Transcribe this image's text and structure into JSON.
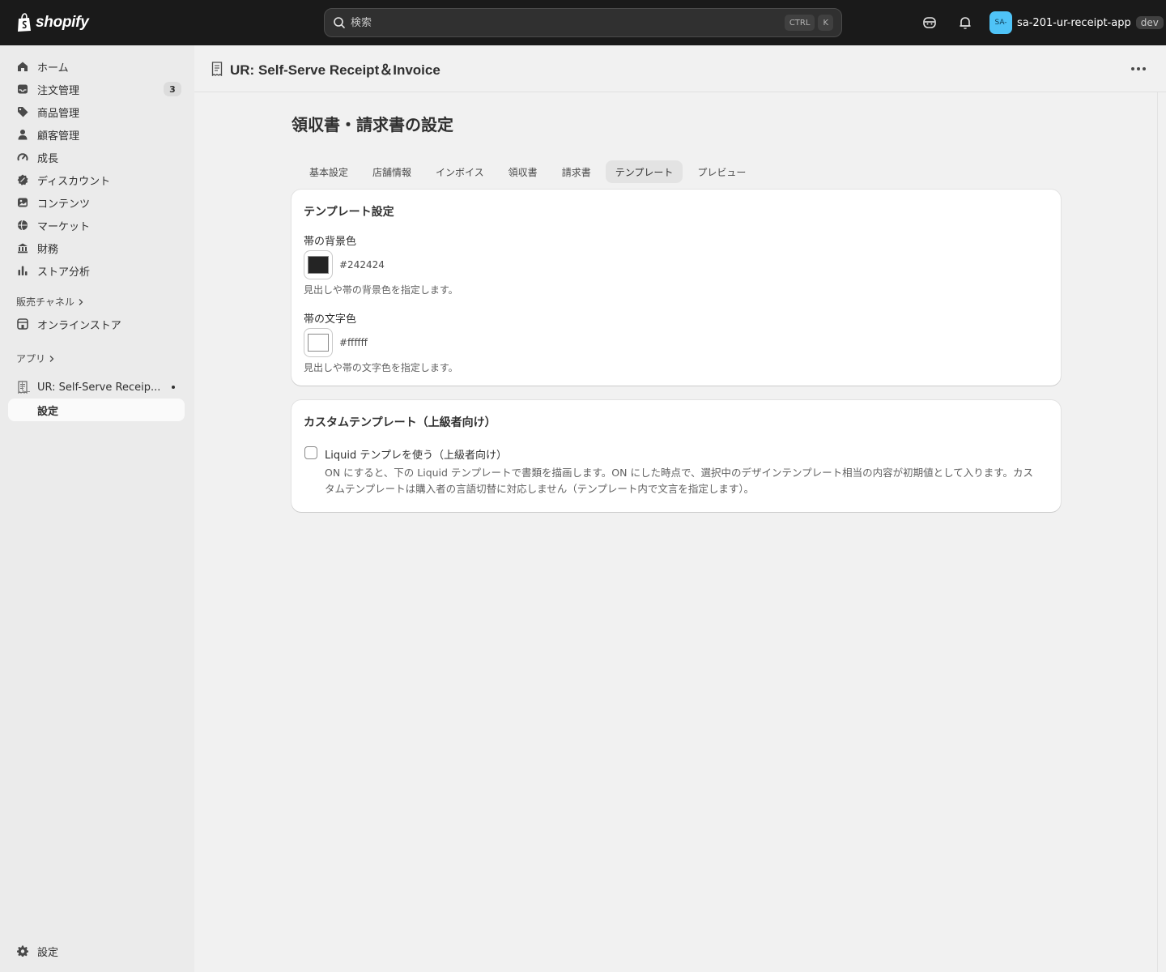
{
  "topbar": {
    "logo_text": "shopify",
    "search_placeholder": "検索",
    "shortcut": [
      "CTRL",
      "K"
    ],
    "account": {
      "avatar_text": "SA-",
      "store_name": "sa-201-ur-receipt-app",
      "badge": "dev"
    }
  },
  "sidebar": {
    "items": [
      {
        "label": "ホーム",
        "icon": "home-icon"
      },
      {
        "label": "注文管理",
        "icon": "inbox-icon",
        "badge": "3"
      },
      {
        "label": "商品管理",
        "icon": "tag-icon"
      },
      {
        "label": "顧客管理",
        "icon": "person-icon"
      },
      {
        "label": "成長",
        "icon": "gauge-icon"
      },
      {
        "label": "ディスカウント",
        "icon": "discount-icon"
      },
      {
        "label": "コンテンツ",
        "icon": "image-icon"
      },
      {
        "label": "マーケット",
        "icon": "globe-icon"
      },
      {
        "label": "財務",
        "icon": "bank-icon"
      },
      {
        "label": "ストア分析",
        "icon": "chart-icon"
      }
    ],
    "sales_channels_label": "販売チャネル",
    "online_store_label": "オンラインストア",
    "apps_label": "アプリ",
    "app_name": "UR: Self-Serve Receip...",
    "app_sub_item": "設定",
    "settings_label": "設定"
  },
  "main": {
    "app_title": "UR: Self-Serve Receipt＆Invoice",
    "page_title": "領収書・請求書の設定",
    "tabs": [
      "基本設定",
      "店舗情報",
      "インボイス",
      "領収書",
      "請求書",
      "テンプレート",
      "プレビュー"
    ],
    "selected_tab": 5,
    "template_card": {
      "title": "テンプレート設定",
      "bg_color_label": "帯の背景色",
      "bg_color_value": "#242424",
      "bg_color_help": "見出しや帯の背景色を指定します。",
      "text_color_label": "帯の文字色",
      "text_color_value": "#ffffff",
      "text_color_help": "見出しや帯の文字色を指定します。"
    },
    "custom_card": {
      "title": "カスタムテンプレート（上級者向け）",
      "checkbox_label": "Liquid テンプレを使う（上級者向け）",
      "checkbox_checked": false,
      "help": "ON にすると、下の Liquid テンプレートで書類を描画します。ON にした時点で、選択中のデザインテンプレート相当の内容が初期値として入ります。カスタムテンプレートは購入者の言語切替に対応しません（テンプレート内で文言を指定します）。"
    }
  }
}
